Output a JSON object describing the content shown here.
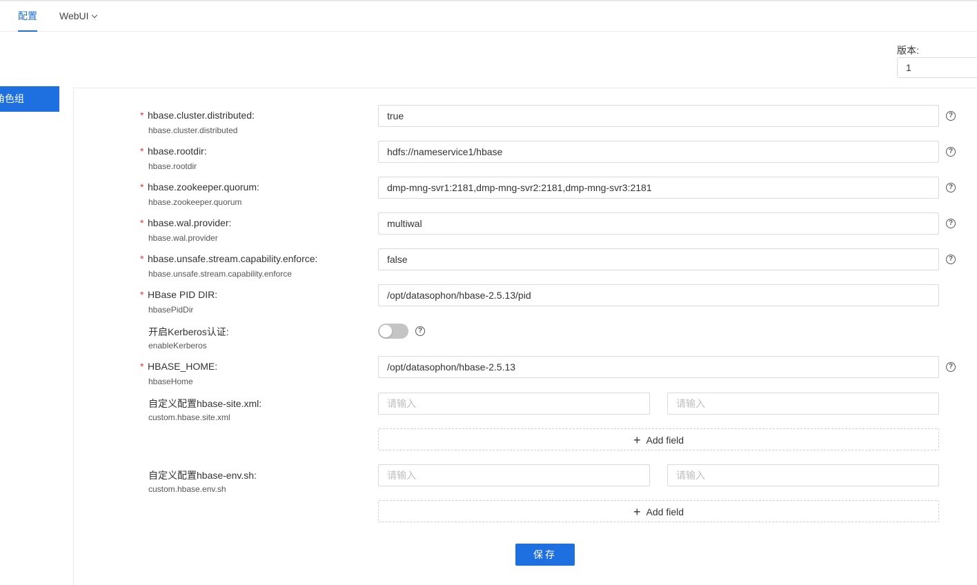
{
  "tabs": {
    "config": "配置",
    "webui": "WebUI"
  },
  "version": {
    "label": "版本:",
    "value": "1"
  },
  "sidebar": {
    "role_group": "角色组"
  },
  "form": {
    "rows": [
      {
        "label": "hbase.cluster.distributed:",
        "key": "hbase.cluster.distributed",
        "value": "true",
        "required": true
      },
      {
        "label": "hbase.rootdir:",
        "key": "hbase.rootdir",
        "value": "hdfs://nameservice1/hbase",
        "required": true
      },
      {
        "label": "hbase.zookeeper.quorum:",
        "key": "hbase.zookeeper.quorum",
        "value": "dmp-mng-svr1:2181,dmp-mng-svr2:2181,dmp-mng-svr3:2181",
        "required": true
      },
      {
        "label": "hbase.wal.provider:",
        "key": "hbase.wal.provider",
        "value": "multiwal",
        "required": true
      },
      {
        "label": "hbase.unsafe.stream.capability.enforce:",
        "key": "hbase.unsafe.stream.capability.enforce",
        "value": "false",
        "required": true
      },
      {
        "label": "HBase PID DIR:",
        "key": "hbasePidDir",
        "value": "/opt/datasophon/hbase-2.5.13/pid",
        "required": true
      },
      {
        "label": "开启Kerberos认证:",
        "key": "enableKerberos",
        "value": "off",
        "required": false
      },
      {
        "label": "HBASE_HOME:",
        "key": "hbaseHome",
        "value": "/opt/datasophon/hbase-2.5.13",
        "required": true
      },
      {
        "label": "自定义配置hbase-site.xml:",
        "key": "custom.hbase.site.xml",
        "required": false
      },
      {
        "label": "自定义配置hbase-env.sh:",
        "key": "custom.hbase.env.sh",
        "required": false
      }
    ],
    "required_mark": "*",
    "help_mark": "?",
    "placeholder": "请输入",
    "add_field": "Add field",
    "add_plus": "+",
    "save": "保存"
  }
}
